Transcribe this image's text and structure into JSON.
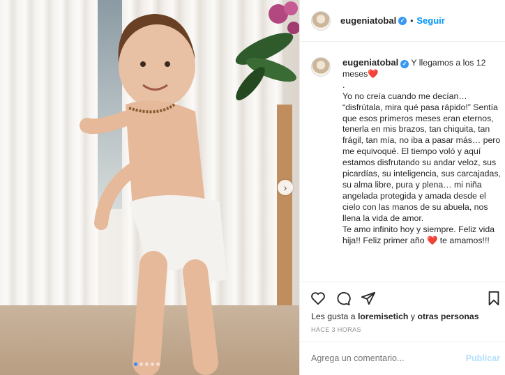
{
  "post": {
    "username": "eugeniatobal",
    "follow_label": "Seguir",
    "separator": "•",
    "caption_lines": [
      " Y llegamos a los 12 meses",
      ".",
      "Yo no creía cuando me decían… “disfrútala, mira qué pasa rápido!” Sentía que esos primeros meses eran eternos, tenerla en mis brazos, tan chiquita, tan frágil, tan mía, no iba a pasar más… pero me equivoqué. El tiempo voló y aquí estamos disfrutando su andar veloz, sus picardías, su inteligencia, sus carcajadas, su alma libre, pura y plena… mi niña angelada protegida y amada desde el cielo con las manos de su abuela, nos llena la vida de amor.",
      "Te amo infinito hoy y siempre. Feliz vida hija!! Feliz primer año ",
      " te amamos!!!"
    ],
    "heart_glyph": "❤️",
    "likes_prefix": "Les gusta a ",
    "liked_by": "loremisetich",
    "likes_middle": " y ",
    "likes_others": "otras personas",
    "timestamp": "HACE 3 HORAS",
    "comment_placeholder": "Agrega un comentario...",
    "publish_label": "Publicar"
  },
  "carousel": {
    "slide_count": 5,
    "active_index": 0,
    "next_glyph": "›"
  },
  "icons": [
    "heart-icon",
    "comment-icon",
    "share-icon",
    "bookmark-icon",
    "verified-icon"
  ],
  "colors": {
    "accent": "#0095f6",
    "heart": "#e0245e",
    "publish_disabled": "#b2dffc",
    "verified": "#3897f0"
  }
}
